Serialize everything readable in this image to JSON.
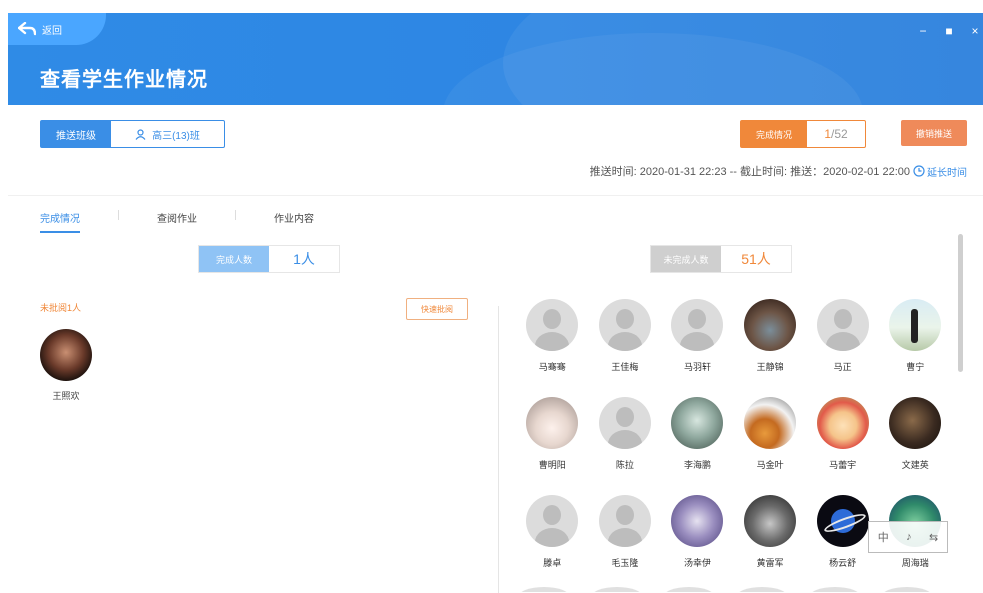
{
  "header": {
    "back_label": "返回",
    "title": "查看学生作业情况",
    "window_controls": [
      "−",
      "■",
      "×"
    ]
  },
  "toolbar": {
    "publish_label": "推送班级",
    "class_label": "高三(13)班",
    "status_label": "完成情况",
    "status_done": "1",
    "status_total": "/52",
    "revoke_label": "撤销推送",
    "time_text": "推送时间: 2020-01-31 22:23 -- 截止时间: 推送：2020-02-01 22:00",
    "extend_label": "延长时间"
  },
  "tabs": [
    {
      "label": "完成情况",
      "active": true
    },
    {
      "label": "查阅作业",
      "active": false
    },
    {
      "label": "作业内容",
      "active": false
    }
  ],
  "completed": {
    "label": "完成人数",
    "count": "1人"
  },
  "uncompleted": {
    "label": "未完成人数",
    "count": "51人"
  },
  "unreviewed_label": "未批阅1人",
  "quick_review_label": "快速批阅",
  "completed_students": [
    {
      "name": "王照欢"
    }
  ],
  "uncompleted_students": [
    [
      {
        "name": "马骞骞",
        "avatar": "default"
      },
      {
        "name": "王佳梅",
        "avatar": "default"
      },
      {
        "name": "马羽轩",
        "avatar": "default"
      },
      {
        "name": "王静锦",
        "avatar": "room"
      },
      {
        "name": "马正",
        "avatar": "default"
      },
      {
        "name": "曹宁",
        "avatar": "man"
      }
    ],
    [
      {
        "name": "曹明阳",
        "avatar": "girl"
      },
      {
        "name": "陈拉",
        "avatar": "default"
      },
      {
        "name": "李海鹏",
        "avatar": "anime"
      },
      {
        "name": "马金叶",
        "avatar": "bball"
      },
      {
        "name": "马蕾宇",
        "avatar": "cartoon"
      },
      {
        "name": "文建英",
        "avatar": "dark"
      }
    ],
    [
      {
        "name": "滕卓",
        "avatar": "default"
      },
      {
        "name": "毛玉隆",
        "avatar": "default"
      },
      {
        "name": "汤幸伊",
        "avatar": "purple"
      },
      {
        "name": "黄雷军",
        "avatar": "hands"
      },
      {
        "name": "杨云舒",
        "avatar": "planet"
      },
      {
        "name": "周海瑞",
        "avatar": "game"
      }
    ]
  ],
  "float_tool_icons": [
    "中",
    "♪",
    "⇆"
  ],
  "colors": {
    "primary": "#3a8ee6",
    "accent": "#f0883a",
    "header": "#2e86e3"
  }
}
